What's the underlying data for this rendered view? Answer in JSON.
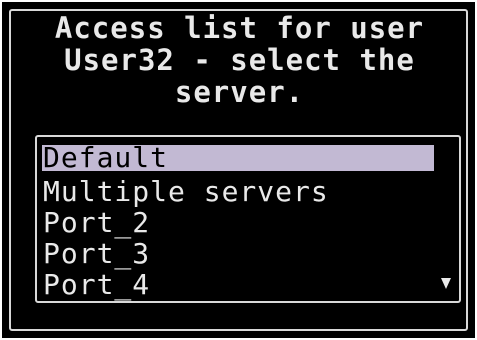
{
  "dialog": {
    "title_lines": [
      "Access list for user",
      "User32 - select the",
      "server."
    ]
  },
  "server_list": {
    "items": [
      "Default",
      "Multiple servers",
      "Port_2",
      "Port_3",
      "Port_4"
    ],
    "selected": "Default",
    "scroll_indicator": "scroll-down-arrow-icon"
  },
  "colors": {
    "background": "#000000",
    "text": "#e9e9e9",
    "border": "#d9d9d9",
    "selection": "#c2b9d3"
  }
}
